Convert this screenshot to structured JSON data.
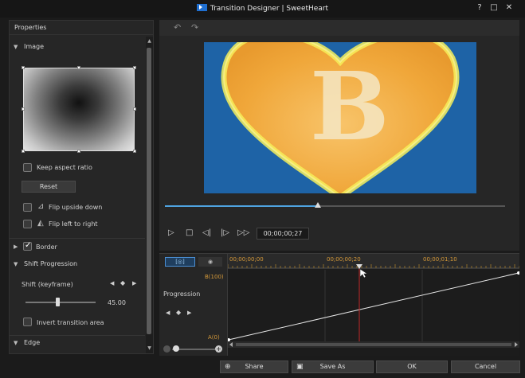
{
  "window": {
    "title": "Transition Designer | SweetHeart",
    "help": "?",
    "restore": "□",
    "close": "✕"
  },
  "properties": {
    "header": "Properties",
    "image_section": "Image",
    "keep_aspect": {
      "label": "Keep aspect ratio",
      "checked": false
    },
    "reset_label": "Reset",
    "flip_upside_down": {
      "label": "Flip upside down",
      "checked": false
    },
    "flip_left_right": {
      "label": "Flip left to right",
      "checked": false
    },
    "border": {
      "label": "Border",
      "checked": true
    },
    "shift_progression_section": "Shift Progression",
    "shift_keyframe_label": "Shift (keyframe)",
    "shift_value": "45.00",
    "shift_level": 0.45,
    "invert": {
      "label": "Invert transition area",
      "checked": false
    },
    "edge_section": "Edge"
  },
  "player": {
    "undo": "↶",
    "redo": "↷",
    "position": 0.45,
    "timecode": "00;00;00;27",
    "preview_letter": "B",
    "colors": {
      "background": "#1e63a6",
      "heart": "#f0a73a",
      "heart_glow": "#f6ee5a"
    }
  },
  "keyframe": {
    "tabs": [
      "[◎]",
      "◉"
    ],
    "ruler_labels": [
      "00;00;00;00",
      "00;00;00;20",
      "00;00;01;10"
    ],
    "track_label": "Progression",
    "axis_top": "B(100)",
    "axis_bottom": "A(0)",
    "line": {
      "start": 0,
      "end": 100
    }
  },
  "buttons": {
    "share": "Share",
    "save_as": "Save As",
    "ok": "OK",
    "cancel": "Cancel"
  }
}
